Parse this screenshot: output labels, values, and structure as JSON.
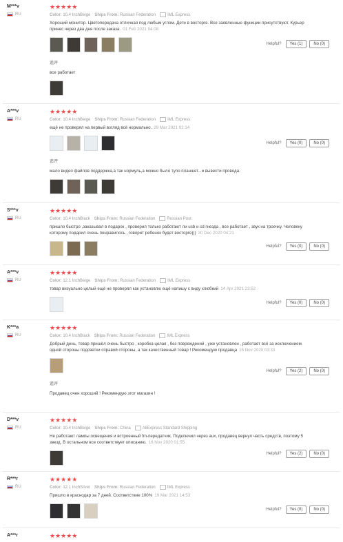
{
  "helpful_label": "Helpful?",
  "followup_label": "追评",
  "stars": "★★★★★",
  "color_label": "Color:",
  "ships_label": "Ships From:",
  "reviews": [
    {
      "user": "M***v",
      "country": "RU",
      "color": "10.4 InchBeige",
      "ships_from": "Russian Federation",
      "shipping": "IML Express",
      "text": "Хороший монитор. Цветопередача отличная под любым углом. Дети в восторге. Все заявленные функции присутствуют. Курьер принес через два дня после заказа.",
      "date": "01 Feb 2021 04:08",
      "yes": "Yes (1)",
      "no": "No (0)",
      "followup": "все работает"
    },
    {
      "user": "A***v",
      "country": "RU",
      "color": "10.4 InchBeige",
      "ships_from": "Russian Federation",
      "shipping": "IML Express",
      "text": "ещё не проверял на первый взгляд всё нормально.",
      "date": "29 Mar 2021 02:14",
      "yes": "Yes (0)",
      "no": "No (0)",
      "followup": "мало видео файлов поддержка,а так нормуль,а можно было тупо планшет...и вывести провода."
    },
    {
      "user": "S***v",
      "country": "RU",
      "color": "10.4 InchBlack",
      "ships_from": "Russian Federation",
      "shipping": "Russian Post",
      "text": "пришло быстро ,заказывал в подарок , проверил только работают ли usb и cd гнезда , все работает , звук на троечку. Человеку которому подарил очень понравилось , говорит ребенок будет восторге)))",
      "date": "30 Dec 2020 04:21",
      "yes": "Yes (0)",
      "no": "No (0)"
    },
    {
      "user": "A***v",
      "country": "RU",
      "color": "12.1 InchBeige",
      "ships_from": "Russian Federation",
      "shipping": "IML Express",
      "text": "товар визуально целый ещё не проверял как установлю ещё напишу с виду хлюбкий",
      "date": "14 Apr 2021 23:52",
      "yes": "Yes (0)",
      "no": "No (0)"
    },
    {
      "user": "K***a",
      "country": "RU",
      "color": "10.4 InchBlack",
      "ships_from": "Russian Federation",
      "shipping": "IML Express",
      "text": "Добрый день, товар пришёл очень быстро , коробка целая , без повреждений , уже установлен , работает всё за исключением одной стороны подсветки справой стороны, а так качественный товар ! Рекомендую продавца",
      "date": "15 Nov 2020 03:33",
      "yes": "Yes (2)",
      "no": "No (0)",
      "followup": "Продавец очен хороший ! Рекомендую этот магазин !"
    },
    {
      "user": "D***v",
      "country": "RU",
      "color": "10.4 InchBeige",
      "ships_from": "China",
      "shipping": "AliExpress Standard Shipping",
      "text": "Не работают лампы освещения и встроенный fm-передатчик. Подключил через aux, продавец вернул часть средств, поэтому 5 звезд. В остальном все соответствует описанию.",
      "date": "16 Nov 2020 01:55",
      "yes": "Yes (2)",
      "no": "No (0)"
    },
    {
      "user": "R***r",
      "country": "RU",
      "color": "12.1 InchSilver",
      "ships_from": "Russian Federation",
      "shipping": "IML Express",
      "text": "Пришло в краснодар за 7 дней. Соответствие 100%",
      "date": "19 Mar 2021 14:53",
      "yes": "Yes (0)",
      "no": "No (0)"
    },
    {
      "user": "A***r",
      "country": "RU"
    }
  ]
}
